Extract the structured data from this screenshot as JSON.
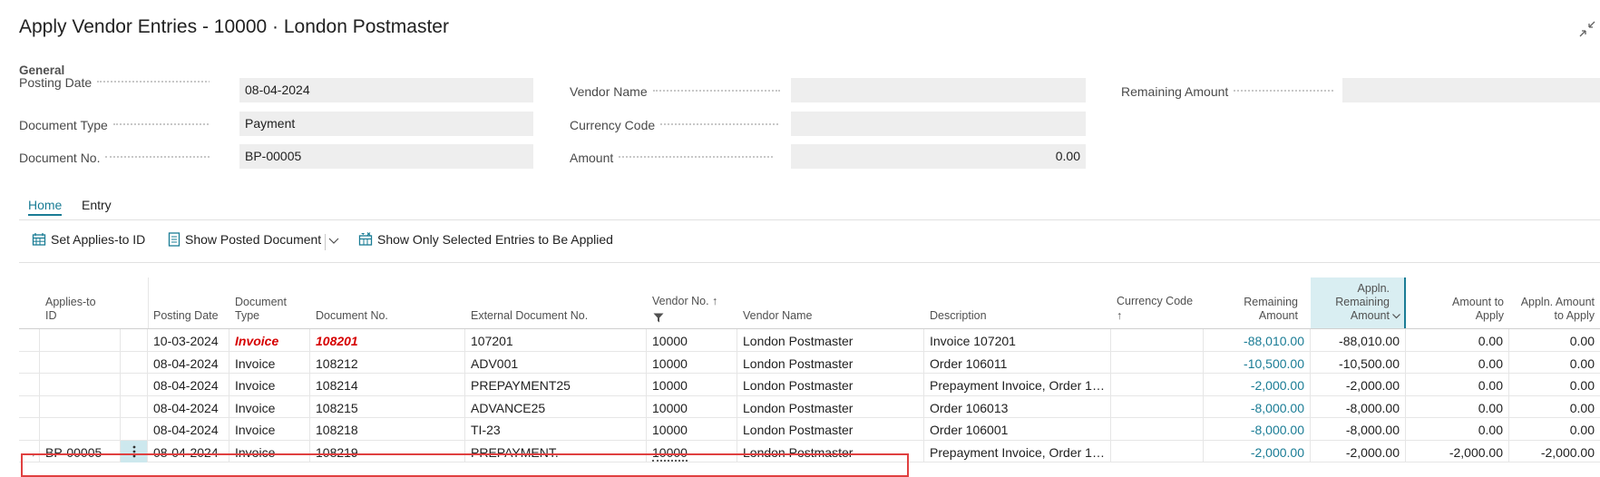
{
  "title": "Apply Vendor Entries - 10000 · London Postmaster",
  "general": {
    "section_label": "General",
    "posting_date_label": "Posting Date",
    "posting_date_value": "08-04-2024",
    "document_type_label": "Document Type",
    "document_type_value": "Payment",
    "document_no_label": "Document No.",
    "document_no_value": "BP-00005",
    "vendor_name_label": "Vendor Name",
    "vendor_name_value": "",
    "currency_code_label": "Currency Code",
    "currency_code_value": "",
    "amount_label": "Amount",
    "amount_value": "0.00",
    "remaining_amount_label": "Remaining Amount",
    "remaining_amount_value": ""
  },
  "tabs": {
    "home": "Home",
    "entry": "Entry"
  },
  "actions": {
    "set_applies_to_id": "Set Applies-to ID",
    "show_posted_document": "Show Posted Document",
    "show_only_selected": "Show Only Selected Entries to Be Applied"
  },
  "columns": {
    "applies_to_id": "Applies-to ID",
    "posting_date": "Posting Date",
    "document_type": "Document Type",
    "document_no": "Document No.",
    "external_document_no": "External Document No.",
    "vendor_no": "Vendor No. ↑",
    "vendor_name": "Vendor Name",
    "description": "Description",
    "currency_code": "Currency Code",
    "currency_code_arrow": "↑",
    "remaining_amount": "Remaining Amount",
    "appln_remaining_amount": "Appln. Remaining Amount",
    "amount_to_apply": "Amount to Apply",
    "appln_amount_to_apply": "Appln. Amount to Apply"
  },
  "rows": [
    {
      "arrow": "",
      "applies_to_id": "",
      "posting_date": "10-03-2024",
      "document_type": "Invoice",
      "document_no": "108201",
      "external_document_no": "107201",
      "vendor_no": "10000",
      "vendor_name": "London Postmaster",
      "description": "Invoice 107201",
      "currency_code": "",
      "remaining_amount": "-88,010.00",
      "appln_remaining_amount": "-88,010.00",
      "amount_to_apply": "0.00",
      "appln_amount_to_apply": "0.00"
    },
    {
      "arrow": "",
      "applies_to_id": "",
      "posting_date": "08-04-2024",
      "document_type": "Invoice",
      "document_no": "108212",
      "external_document_no": "ADV001",
      "vendor_no": "10000",
      "vendor_name": "London Postmaster",
      "description": "Order 106011",
      "currency_code": "",
      "remaining_amount": "-10,500.00",
      "appln_remaining_amount": "-10,500.00",
      "amount_to_apply": "0.00",
      "appln_amount_to_apply": "0.00"
    },
    {
      "arrow": "",
      "applies_to_id": "",
      "posting_date": "08-04-2024",
      "document_type": "Invoice",
      "document_no": "108214",
      "external_document_no": "PREPAYMENT25",
      "vendor_no": "10000",
      "vendor_name": "London Postmaster",
      "description": "Prepayment Invoice, Order 10...",
      "currency_code": "",
      "remaining_amount": "-2,000.00",
      "appln_remaining_amount": "-2,000.00",
      "amount_to_apply": "0.00",
      "appln_amount_to_apply": "0.00"
    },
    {
      "arrow": "",
      "applies_to_id": "",
      "posting_date": "08-04-2024",
      "document_type": "Invoice",
      "document_no": "108215",
      "external_document_no": "ADVANCE25",
      "vendor_no": "10000",
      "vendor_name": "London Postmaster",
      "description": "Order 106013",
      "currency_code": "",
      "remaining_amount": "-8,000.00",
      "appln_remaining_amount": "-8,000.00",
      "amount_to_apply": "0.00",
      "appln_amount_to_apply": "0.00"
    },
    {
      "arrow": "",
      "applies_to_id": "",
      "posting_date": "08-04-2024",
      "document_type": "Invoice",
      "document_no": "108218",
      "external_document_no": "TI-23",
      "vendor_no": "10000",
      "vendor_name": "London Postmaster",
      "description": "Order 106001",
      "currency_code": "",
      "remaining_amount": "-8,000.00",
      "appln_remaining_amount": "-8,000.00",
      "amount_to_apply": "0.00",
      "appln_amount_to_apply": "0.00"
    },
    {
      "arrow": "→",
      "applies_to_id": "BP-00005",
      "posting_date": "08-04-2024",
      "document_type": "Invoice",
      "document_no": "108219",
      "external_document_no": "PREPAYMENT.",
      "vendor_no": "10000",
      "vendor_name": "London Postmaster",
      "description": "Prepayment Invoice, Order 10...",
      "currency_code": "",
      "remaining_amount": "-2,000.00",
      "appln_remaining_amount": "-2,000.00",
      "amount_to_apply": "-2,000.00",
      "appln_amount_to_apply": "-2,000.00"
    }
  ],
  "colors": {
    "accent": "#1a7c95",
    "link_amount": "#1a7c95",
    "overdue_red": "#d60000",
    "highlight_border": "#e04040",
    "field_bg": "#eeeeee"
  }
}
